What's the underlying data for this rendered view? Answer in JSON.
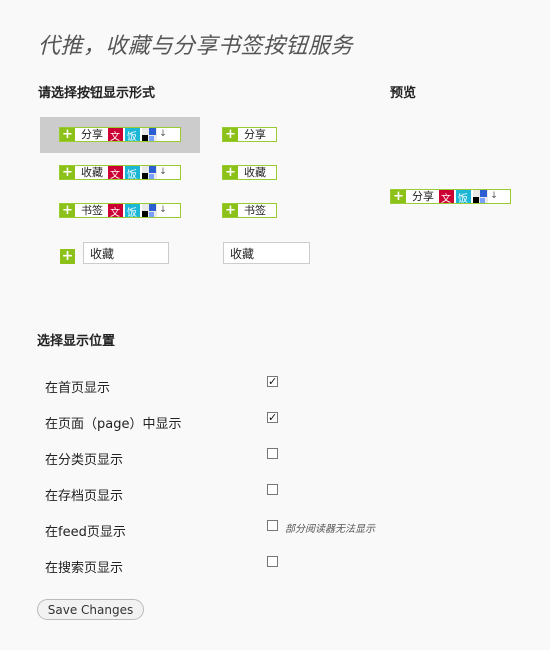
{
  "page": {
    "title": "代推，收藏与分享书签按钮服务"
  },
  "style_section": {
    "heading": "请选择按钮显示形式",
    "buttons": {
      "share": "分享",
      "favorite": "收藏",
      "bookmark": "书签"
    },
    "textbox_values": [
      "收藏",
      "收藏"
    ],
    "selected_style": 1
  },
  "preview": {
    "heading": "预览",
    "button_label": "分享"
  },
  "position_section": {
    "heading": "选择显示位置",
    "options": [
      {
        "label": "在首页显示",
        "checked": true
      },
      {
        "label": "在页面（page）中显示",
        "checked": true
      },
      {
        "label": "在分类页显示",
        "checked": false
      },
      {
        "label": "在存档页显示",
        "checked": false
      },
      {
        "label": "在feed页显示",
        "checked": false,
        "note": "部分阅读器无法显示"
      },
      {
        "label": "在搜索页显示",
        "checked": false
      }
    ]
  },
  "actions": {
    "save_label": "Save Changes"
  },
  "colors": {
    "accent_green": "#8cc11a",
    "icon_red": "#cc0033",
    "icon_cyan": "#1cb6d6"
  },
  "icons": [
    "plus-icon",
    "renren-icon",
    "fanfou-icon",
    "qr-icon",
    "more-arrow-icon"
  ]
}
